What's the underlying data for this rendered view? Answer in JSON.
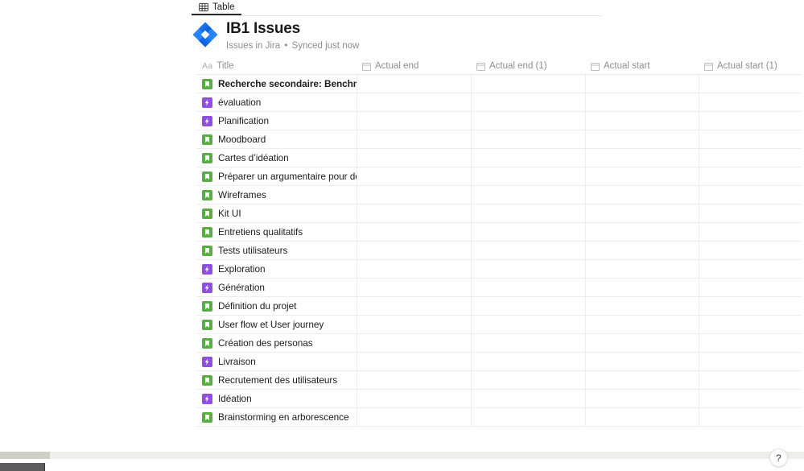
{
  "tabs": [
    {
      "label": "Table",
      "icon": "table-icon",
      "active": true
    }
  ],
  "database": {
    "logo_icon": "jira-logo-icon",
    "title": "IB1 Issues",
    "source": "Issues in Jira",
    "separator": "•",
    "sync_status": "Synced just now"
  },
  "table": {
    "columns": [
      {
        "label": "Title",
        "icon": "text-type-icon",
        "icon_glyph": "Aa"
      },
      {
        "label": "Actual end",
        "icon": "date-type-icon"
      },
      {
        "label": "Actual end (1)",
        "icon": "date-type-icon"
      },
      {
        "label": "Actual start",
        "icon": "date-type-icon"
      },
      {
        "label": "Actual start (1)",
        "icon": "date-type-icon"
      }
    ],
    "rows": [
      {
        "title": "Recherche secondaire: Benchmark, Desk research",
        "type": "story"
      },
      {
        "title": "évaluation",
        "type": "epic"
      },
      {
        "title": "Planification",
        "type": "epic"
      },
      {
        "title": "Moodboard",
        "type": "story"
      },
      {
        "title": "Cartes d’idéation",
        "type": "story"
      },
      {
        "title": "Préparer un argumentaire pour défendre le projet",
        "type": "story"
      },
      {
        "title": "Wireframes",
        "type": "story"
      },
      {
        "title": "Kit UI",
        "type": "story"
      },
      {
        "title": "Entretiens qualitatifs",
        "type": "story"
      },
      {
        "title": "Tests utilisateurs",
        "type": "story"
      },
      {
        "title": "Exploration",
        "type": "epic"
      },
      {
        "title": "Génération",
        "type": "epic"
      },
      {
        "title": "Définition du projet",
        "type": "story"
      },
      {
        "title": "User flow et User journey",
        "type": "story"
      },
      {
        "title": "Création des personas",
        "type": "story"
      },
      {
        "title": "Livraison",
        "type": "epic"
      },
      {
        "title": "Recrutement des utilisateurs",
        "type": "story"
      },
      {
        "title": "Idéation",
        "type": "epic"
      },
      {
        "title": "Brainstorming en arborescence",
        "type": "story"
      }
    ]
  },
  "help": {
    "label": "?"
  },
  "colors": {
    "story_green": "#5AAC44",
    "epic_purple": "#904EE2",
    "jira_blue": "#2684FF",
    "jira_blue_dark": "#0052CC",
    "tab_underline": "#2b2b2b",
    "grid_line": "#ededed",
    "muted_text": "#8f8f8f"
  }
}
